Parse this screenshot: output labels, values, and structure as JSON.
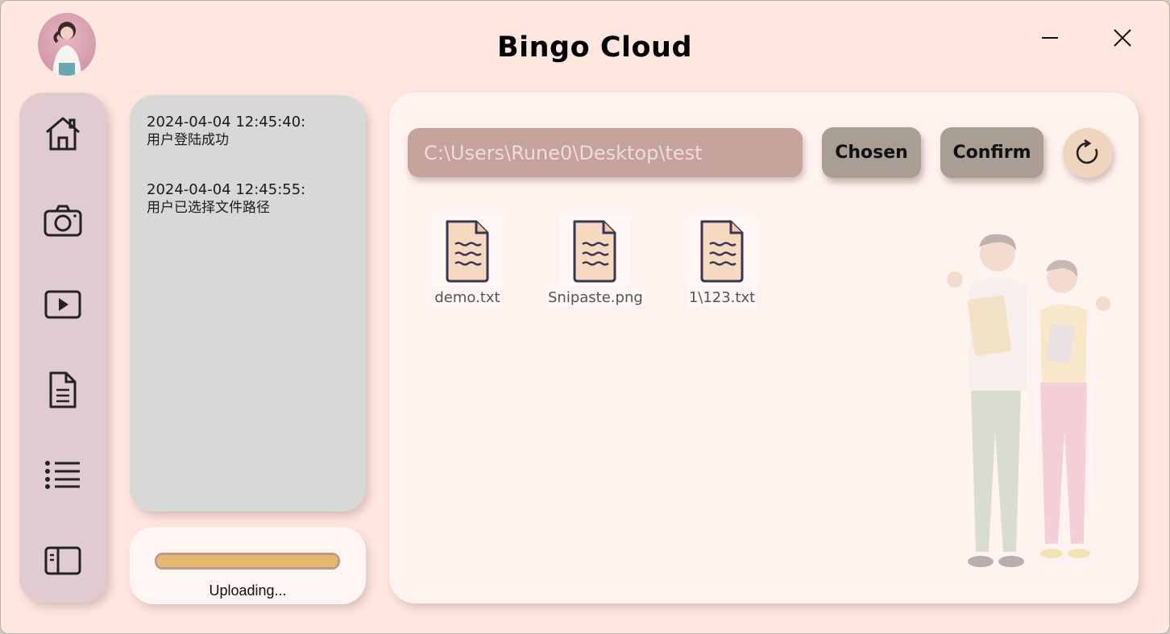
{
  "app": {
    "title": "Bingo Cloud"
  },
  "window_controls": {
    "minimize": "minimize-icon",
    "close": "close-icon"
  },
  "sidebar": {
    "items": [
      {
        "icon": "home-icon"
      },
      {
        "icon": "camera-icon"
      },
      {
        "icon": "play-icon"
      },
      {
        "icon": "document-icon"
      },
      {
        "icon": "list-icon"
      },
      {
        "icon": "sidebar-panel-icon"
      }
    ]
  },
  "log": {
    "entries": [
      {
        "time": "2024-04-04 12:45:40:",
        "message": "用户登陆成功"
      },
      {
        "time": "2024-04-04 12:45:55:",
        "message": "用户已选择文件路径"
      }
    ]
  },
  "upload": {
    "status": "Uploading...",
    "progress": 1.0
  },
  "main": {
    "path_value": "C:\\Users\\Rune0\\Desktop\\test",
    "chosen_label": "Chosen",
    "confirm_label": "Confirm",
    "refresh_icon": "refresh-icon",
    "files": [
      {
        "name": "demo.txt"
      },
      {
        "name": "Snipaste.png"
      },
      {
        "name": "1\\123.txt"
      }
    ]
  },
  "colors": {
    "window_bg": "#ffe6df",
    "sidebar_bg": "#dfcbd0",
    "log_bg": "#d7d9d7",
    "input_bg": "#c5a29b",
    "button_bg": "#a89e93",
    "progress": "#e5b870"
  }
}
